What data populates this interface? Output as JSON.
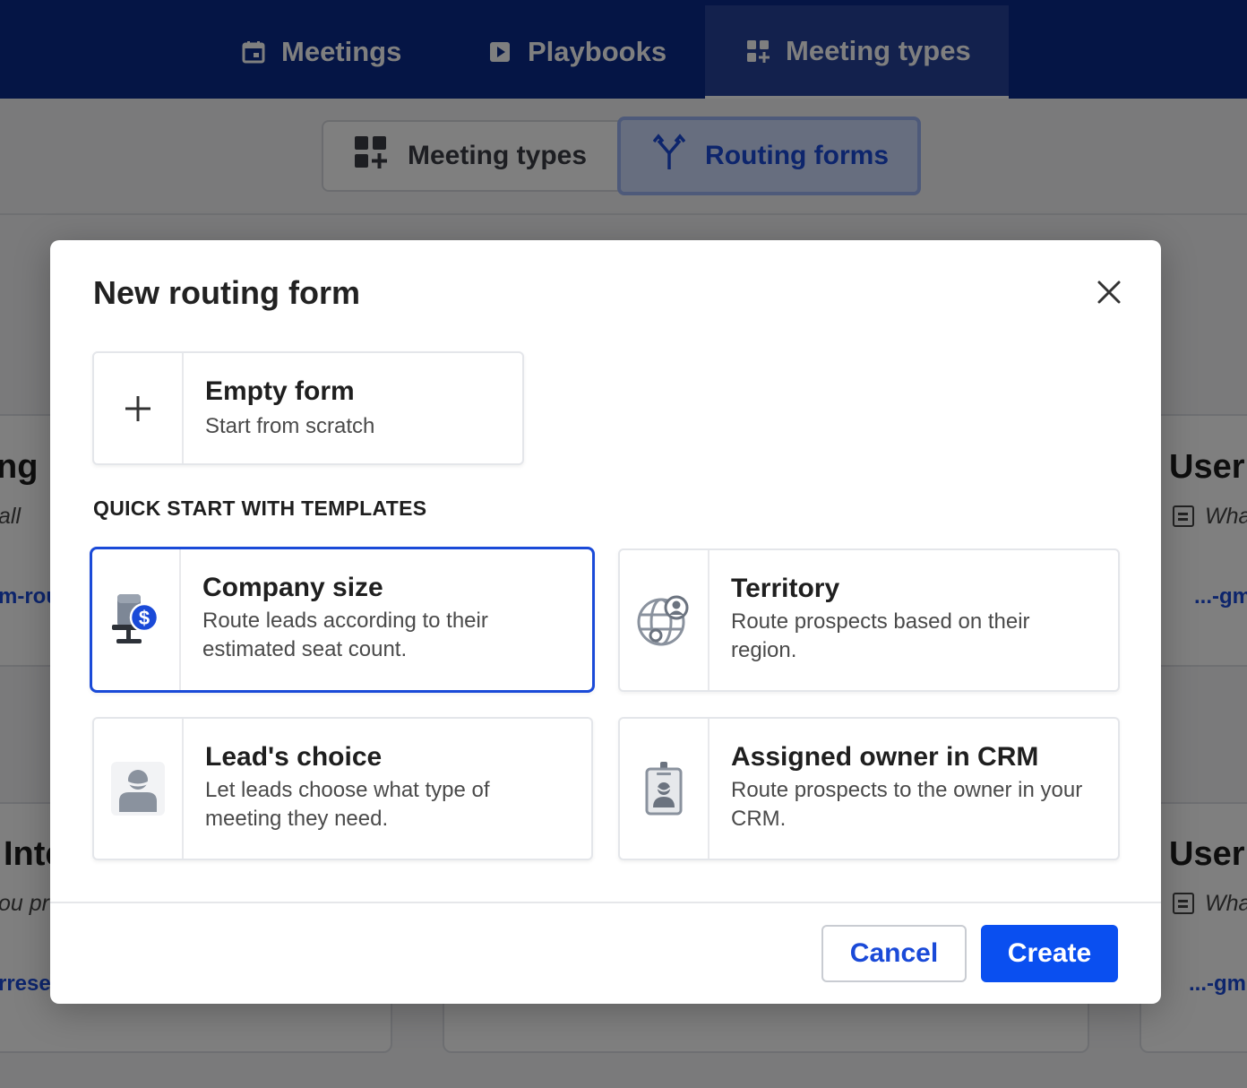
{
  "topnav": {
    "tabs": [
      {
        "label": "Meetings",
        "icon": "calendar-icon"
      },
      {
        "label": "Playbooks",
        "icon": "play-icon"
      },
      {
        "label": "Meeting types",
        "icon": "grid-plus-icon",
        "active": true
      }
    ]
  },
  "subnav": {
    "tabs": [
      {
        "label": "Meeting types",
        "icon": "grid-plus-icon"
      },
      {
        "label": "Routing forms",
        "icon": "routing-fork-icon",
        "active": true
      }
    ]
  },
  "background": {
    "left_row1": {
      "title": "ng",
      "sub": "all",
      "link": "m-rou"
    },
    "right_row1": {
      "title": "User I",
      "sub": "Wha",
      "link": "...-gm"
    },
    "left_row2": {
      "title": "Inte",
      "sub": "ou pr",
      "link": "rrese"
    },
    "right_row2": {
      "title": "User I",
      "sub": "Wha",
      "link": "...-gmb"
    }
  },
  "modal": {
    "title": "New routing form",
    "empty_form": {
      "title": "Empty form",
      "description": "Start from scratch",
      "icon": "plus-icon"
    },
    "templates_label": "QUICK START WITH TEMPLATES",
    "templates": [
      {
        "title": "Company size",
        "description_1": "Route leads according to their",
        "description_2": "estimated seat count.",
        "icon": "office-chair-dollar-icon",
        "selected": true
      },
      {
        "title": "Territory",
        "description_1": "Route prospects based on their",
        "description_2": "region.",
        "icon": "globe-user-icon"
      },
      {
        "title": "Lead's choice",
        "description_1": "Let leads choose what type of",
        "description_2": "meeting they need.",
        "icon": "person-icon"
      },
      {
        "title": "Assigned owner in CRM",
        "description_1": "Route prospects to the owner in your",
        "description_2": "CRM.",
        "icon": "id-badge-icon"
      }
    ],
    "cancel_label": "Cancel",
    "create_label": "Create"
  },
  "colors": {
    "nav_bg": "#0b2a8a",
    "accent": "#1a4ad8",
    "primary_button": "#0a4ff0"
  }
}
